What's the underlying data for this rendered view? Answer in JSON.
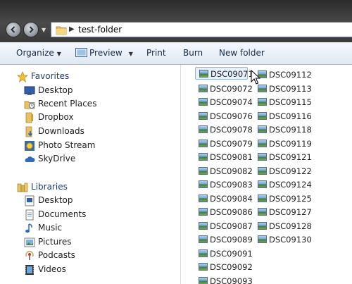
{
  "address_bar": {
    "path": "test-folder"
  },
  "toolbar": {
    "organize": "Organize",
    "preview": "Preview",
    "print": "Print",
    "burn": "Burn",
    "new_folder": "New folder"
  },
  "nav": {
    "favorites_header": "Favorites",
    "favorites": [
      "Desktop",
      "Recent Places",
      "Dropbox",
      "Downloads",
      "Photo Stream",
      "SkyDrive"
    ],
    "libraries_header": "Libraries",
    "libraries": [
      "Desktop",
      "Documents",
      "Music",
      "Pictures",
      "Podcasts",
      "Videos"
    ]
  },
  "files": {
    "column1": [
      "DSC09071",
      "DSC09072",
      "DSC09074",
      "DSC09076",
      "DSC09078",
      "DSC09079",
      "DSC09081",
      "DSC09082",
      "DSC09083",
      "DSC09084",
      "DSC09086",
      "DSC09087",
      "DSC09089",
      "DSC09091",
      "DSC09092",
      "DSC09093"
    ],
    "column2": [
      "DSC09112",
      "DSC09113",
      "DSC09115",
      "DSC09116",
      "DSC09118",
      "DSC09119",
      "DSC09121",
      "DSC09122",
      "DSC09124",
      "DSC09125",
      "DSC09127",
      "DSC09128",
      "DSC09130"
    ],
    "selected": "DSC09071"
  }
}
